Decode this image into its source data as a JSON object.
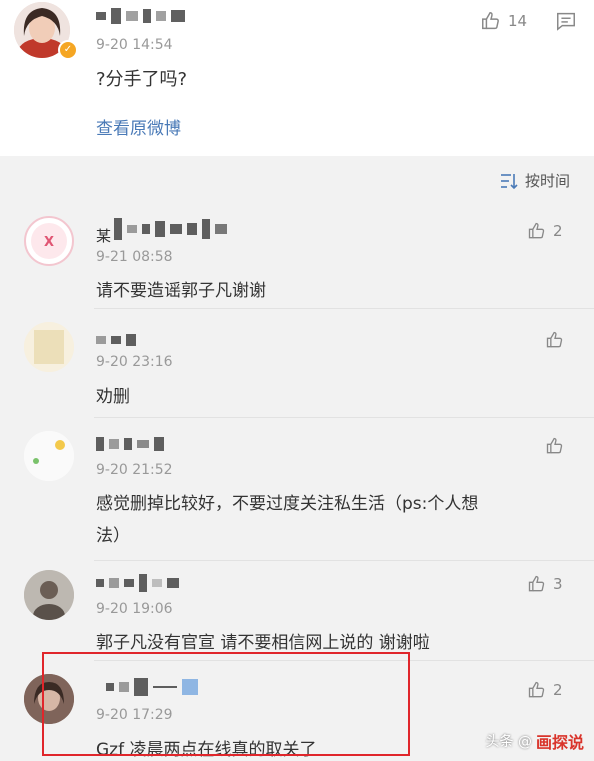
{
  "post": {
    "time": "9-20 14:54",
    "text": "?分手了吗?",
    "view_original": "查看原微博",
    "like_count": "14"
  },
  "sort": {
    "label": "按时间"
  },
  "comments": [
    {
      "time": "9-21 08:58",
      "text": "请不要造谣郭子凡谢谢",
      "likes": "2",
      "name_prefix": "某"
    },
    {
      "time": "9-20 23:16",
      "text": "劝删",
      "likes": ""
    },
    {
      "time": "9-20 21:52",
      "text": "感觉删掉比较好，不要过度关注私生活（ps:个人想",
      "text2": "法）",
      "likes": ""
    },
    {
      "time": "9-20 19:06",
      "text": "郭子凡没有官宣 请不要相信网上说的 谢谢啦",
      "likes": "3"
    },
    {
      "time": "9-20 17:29",
      "text": "Gzf 凌晨两点在线真的取关了",
      "likes": "2"
    }
  ],
  "watermark": {
    "prefix": "头条 @",
    "strong": "画探说"
  },
  "colors": {
    "link": "#4a7ab7",
    "highlight_box": "#e0262b",
    "badge": "#f5a623"
  }
}
